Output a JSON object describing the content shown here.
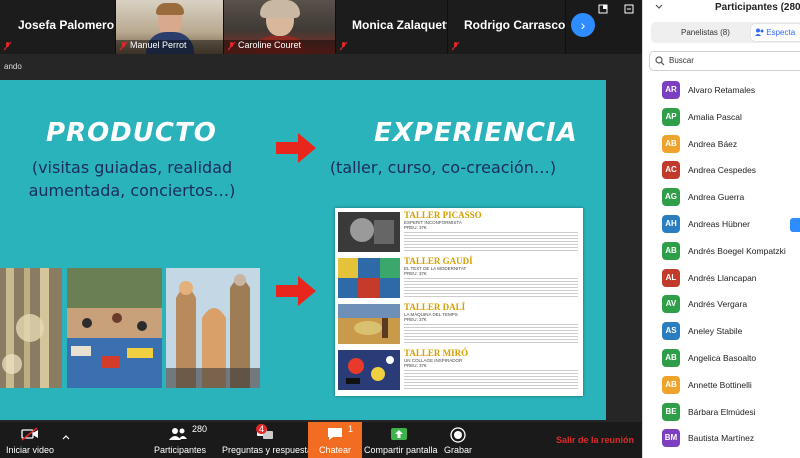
{
  "gallery": {
    "tiles": [
      {
        "name": "Josefa Palomero"
      },
      {
        "name": "Manuel Perrot"
      },
      {
        "name": "Caroline Couret"
      },
      {
        "name": "Monica Zalaquett"
      },
      {
        "name": "Rodrigo Carrasco"
      }
    ],
    "next_glyph": "›"
  },
  "share": {
    "banner_text": "ando"
  },
  "slide": {
    "left_title": "PRODUCTO",
    "left_sub_1": "(visitas guiadas, realidad",
    "left_sub_2": "aumentada, conciertos…)",
    "right_title": "EXPERIENCIA",
    "right_sub": "(taller, curso, co-creación…)",
    "catalog": [
      {
        "title": "TALLER PICASSO",
        "sub": "ESPERIT INCONFORMISTA",
        "price": "PREU: 37€"
      },
      {
        "title": "TALLER GAUDÍ",
        "sub": "EL TEXT DE LA MODERNITAT",
        "price": "PREU: 37€"
      },
      {
        "title": "TALLER DALÍ",
        "sub": "LA MÀQUINA DEL TEMPS",
        "price": "PREU: 37€"
      },
      {
        "title": "TALLER MIRÓ",
        "sub": "UN COLLAGE INSPIRADOR",
        "price": "PREU: 37€"
      }
    ]
  },
  "toolbar": {
    "video_label": "Iniciar video",
    "participants_label": "Participantes",
    "participants_count": "280",
    "qa_label": "Preguntas y respuestas",
    "qa_badge": "4",
    "chat_label": "Chatear",
    "chat_badge": "1",
    "share_label": "Compartir pantalla",
    "record_label": "Grabar",
    "leave_label": "Salir de la reunión"
  },
  "panel": {
    "title": "Participantes (280)",
    "tab_panelists": "Panelistas (8)",
    "tab_attendees": "Especta",
    "search_placeholder": "Buscar",
    "participants": [
      {
        "initials": "AR",
        "name": "Alvaro Retamales",
        "color": "#7b3fbf"
      },
      {
        "initials": "AP",
        "name": "Amalia Pascal",
        "color": "#2e9e48"
      },
      {
        "initials": "AB",
        "name": "Andrea Báez",
        "color": "#f0a32a"
      },
      {
        "initials": "AC",
        "name": "Andrea Cespedes",
        "color": "#c23b2a"
      },
      {
        "initials": "AG",
        "name": "Andrea Guerra",
        "color": "#2e9e48"
      },
      {
        "initials": "AH",
        "name": "Andreas Hübner",
        "color": "#2a7ec0"
      },
      {
        "initials": "AB",
        "name": "Andrés Boegel Kompatzki",
        "color": "#2e9e48"
      },
      {
        "initials": "AL",
        "name": "Andrés Llancapan",
        "color": "#c23b2a"
      },
      {
        "initials": "AV",
        "name": "Andrés Vergara",
        "color": "#2e9e48"
      },
      {
        "initials": "AS",
        "name": "Aneley Stabile",
        "color": "#2a7ec0"
      },
      {
        "initials": "AB",
        "name": "Angelica Basoalto",
        "color": "#2e9e48"
      },
      {
        "initials": "AB",
        "name": "Annette Bottinelli",
        "color": "#f0a32a"
      },
      {
        "initials": "BE",
        "name": "Bárbara Elmúdesi",
        "color": "#2e9e48"
      },
      {
        "initials": "BM",
        "name": "Bautista Martínez",
        "color": "#7b3fbf"
      }
    ]
  }
}
